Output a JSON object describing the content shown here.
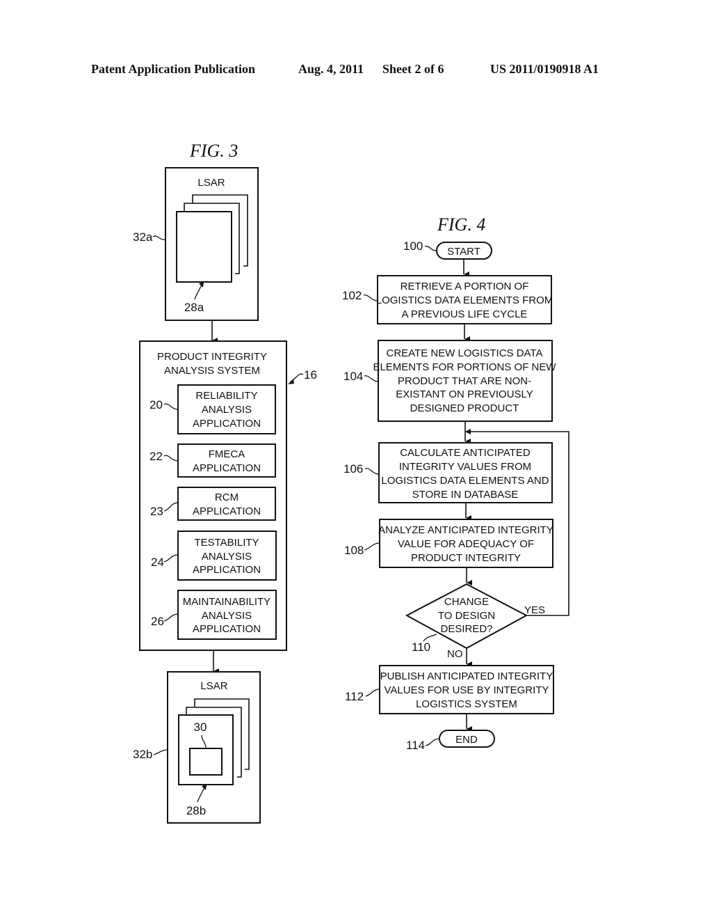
{
  "header": {
    "publication_type": "Patent Application Publication",
    "date": "Aug. 4, 2011",
    "sheet": "Sheet 2 of 6",
    "patent_number": "US 2011/0190918 A1"
  },
  "fig3": {
    "title": "FIG. 3",
    "lsar_top": {
      "label": "LSAR",
      "ref": "32a",
      "document_ref": "28a"
    },
    "system": {
      "title_line1": "PRODUCT INTEGRITY",
      "title_line2": "ANALYSIS SYSTEM",
      "ref": "16",
      "applications": [
        {
          "ref": "20",
          "lines": [
            "RELIABILITY",
            "ANALYSIS",
            "APPLICATION"
          ]
        },
        {
          "ref": "22",
          "lines": [
            "FMECA",
            "APPLICATION"
          ]
        },
        {
          "ref": "23",
          "lines": [
            "RCM",
            "APPLICATION"
          ]
        },
        {
          "ref": "24",
          "lines": [
            "TESTABILITY",
            "ANALYSIS",
            "APPLICATION"
          ]
        },
        {
          "ref": "26",
          "lines": [
            "MAINTAINABILITY",
            "ANALYSIS",
            "APPLICATION"
          ]
        }
      ]
    },
    "lsar_bottom": {
      "label": "LSAR",
      "ref": "32b",
      "document_ref": "28b",
      "inner_ref": "30"
    }
  },
  "fig4": {
    "title": "FIG. 4",
    "start": {
      "ref": "100",
      "label": "START"
    },
    "steps": [
      {
        "ref": "102",
        "lines": [
          "RETRIEVE A PORTION OF",
          "LOGISTICS DATA ELEMENTS FROM",
          "A PREVIOUS LIFE CYCLE"
        ]
      },
      {
        "ref": "104",
        "lines": [
          "CREATE NEW LOGISTICS DATA",
          "ELEMENTS FOR PORTIONS OF NEW",
          "PRODUCT THAT ARE NON-",
          "EXISTANT ON PREVIOUSLY",
          "DESIGNED PRODUCT"
        ]
      },
      {
        "ref": "106",
        "lines": [
          "CALCULATE ANTICIPATED",
          "INTEGRITY VALUES FROM",
          "LOGISTICS DATA ELEMENTS AND",
          "STORE IN DATABASE"
        ]
      },
      {
        "ref": "108",
        "lines": [
          "ANALYZE ANTICIPATED INTEGRITY",
          "VALUE FOR ADEQUACY OF",
          "PRODUCT INTEGRITY"
        ]
      }
    ],
    "decision": {
      "ref": "110",
      "lines": [
        "CHANGE",
        "TO DESIGN",
        "DESIRED?"
      ],
      "yes_label": "YES",
      "no_label": "NO"
    },
    "publish": {
      "ref": "112",
      "lines": [
        "PUBLISH ANTICIPATED INTEGRITY",
        "VALUES FOR USE BY INTEGRITY",
        "LOGISTICS SYSTEM"
      ]
    },
    "end": {
      "ref": "114",
      "label": "END"
    }
  }
}
